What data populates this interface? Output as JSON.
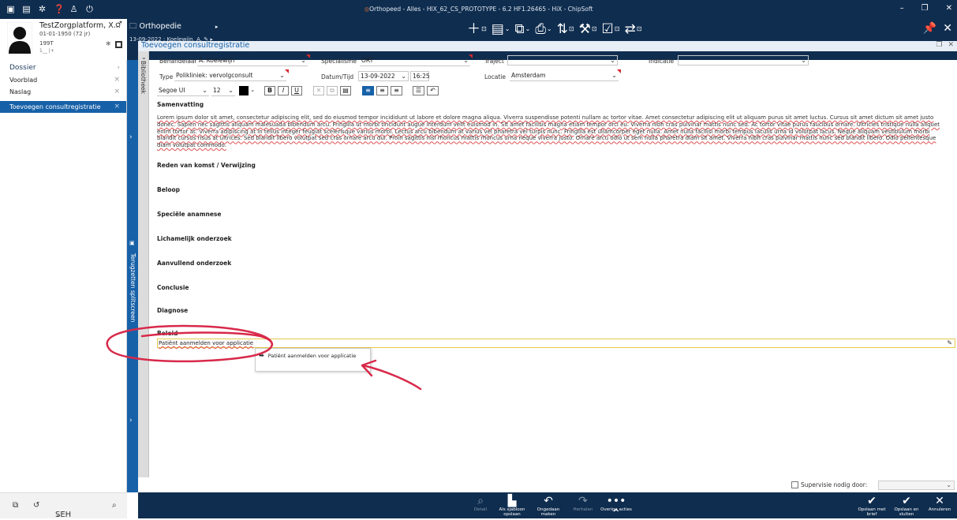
{
  "window": {
    "title": "Orthopeed - Alles - HIX_62_CS_PROTOTYPE - 6.2 HF1.26465 - HiX - ChipSoft",
    "quick_icons": [
      "clipboard-icon",
      "clipboard-check-icon",
      "gear-icon",
      "help-icon",
      "user-icon",
      "power-icon"
    ]
  },
  "patient": {
    "name": "TestZorgplatform, X...",
    "dob": "01-01-1950 (72 jr)",
    "id": "199T",
    "sub": "1__ |+"
  },
  "context": {
    "department": "Orthopedie",
    "date_doctor": "13-09-2022 : Koelewijn, A."
  },
  "sidebar": {
    "items": [
      {
        "label": "Dossier",
        "right": "›"
      },
      {
        "label": "Voorblad",
        "right": "×"
      },
      {
        "label": "Naslag",
        "right": "×"
      },
      {
        "label": "Toevoegen consultregistratie",
        "right": "×"
      }
    ],
    "footer_label": "SEH"
  },
  "splitters": {
    "bibliotheek": "Bibliotheek",
    "terug": "Terugzetten splitscreen"
  },
  "form": {
    "title": "Toevoegen consultregistratie",
    "behandelaar": {
      "label": "Behandelaar",
      "value": "A. Koelewijn"
    },
    "specialisme": {
      "label": "Specialisme",
      "value": "ORT"
    },
    "traject": {
      "label": "Traject",
      "value": ""
    },
    "indicatie": {
      "label": "Indicatie",
      "value": ""
    },
    "type": {
      "label": "Type",
      "value": "Polikliniek: vervolgconsult"
    },
    "datum": {
      "label": "Datum/Tijd",
      "date": "13-09-2022",
      "time": "16:25"
    },
    "locatie": {
      "label": "Locatie",
      "value": "Amsterdam"
    },
    "font": {
      "family": "Segoe UI",
      "size": "12"
    }
  },
  "editor": {
    "samenvatting_title": "Samenvatting",
    "samenvatting_text": "Lorem ipsum dolor sit amet, consectetur adipiscing elit, sed do eiusmod tempor incididunt ut labore et dolore magna aliqua. Viverra suspendisse potenti nullam ac tortor vitae. Amet consectetur adipiscing elit ut aliquam purus sit amet luctus. Cursus sit amet dictum sit amet justo donec. Sapien nec sagittis aliquam malesuada bibendum arcu. Fringilla ut morbi tincidunt augue interdum velit euismod in. Sit amet facilisis magna etiam tempor orci eu. Viverra nibh cras pulvinar mattis nunc sed. Ac tortor vitae purus faucibus ornare. Ultricies tristique nulla aliquet enim tortor at. Viverra adipiscing at in tellus integer feugiat scelerisque varius morbi. Lectus arcu bibendum at varius vel pharetra vel turpis nunc. Fringilla est ullamcorper eget nulla. Amet nulla facilisi morbi tempus iaculis urna id volutpat lacus. Neque aliquam vestibulum morbi blandit cursus risus at ultrices. Sed blandit libero volutpat sed cras ornare arcu dui. Proin sagittis nisl rhoncus mattis rhoncus urna neque viverra justo. Ornare arcu odio ut sem nulla pharetra diam sit amet. Viverra nibh cras pulvinar mattis nunc sed blandit libero. Odio pellentesque diam volutpat commodo.",
    "sections": {
      "reden": "Reden van komst / Verwijzing",
      "beloop": "Beloop",
      "speciele": "Speciële anamnese",
      "lichamelijk": "Lichamelijk onderzoek",
      "aanvullend": "Aanvullend onderzoek",
      "conclusie": "Conclusie",
      "diagnose": "Diagnose",
      "beleid": "Beleid"
    },
    "beleid_value": "Patiënt aanmelden voor applicatie",
    "suggestion": "Patiënt aanmelden voor applicatie"
  },
  "supervisie": {
    "label": "Supervisie nodig door:",
    "value": ""
  },
  "bottom_bar": {
    "detail": "Detail",
    "als_sjabloon": "Als sjabloon opslaan",
    "ongedaan": "Ongedaan maken",
    "herhalen": "Herhalen",
    "overige": "Overige acties",
    "opslaan_brief": "Opslaan met brief",
    "opslaan_sluiten": "Opslaan en sluiten",
    "annuleren": "Annuleren"
  },
  "colors": {
    "navy": "#0f2d4f",
    "accent": "#1761a8",
    "annotation": "#d8294a",
    "required_flag": "#d4262c"
  }
}
